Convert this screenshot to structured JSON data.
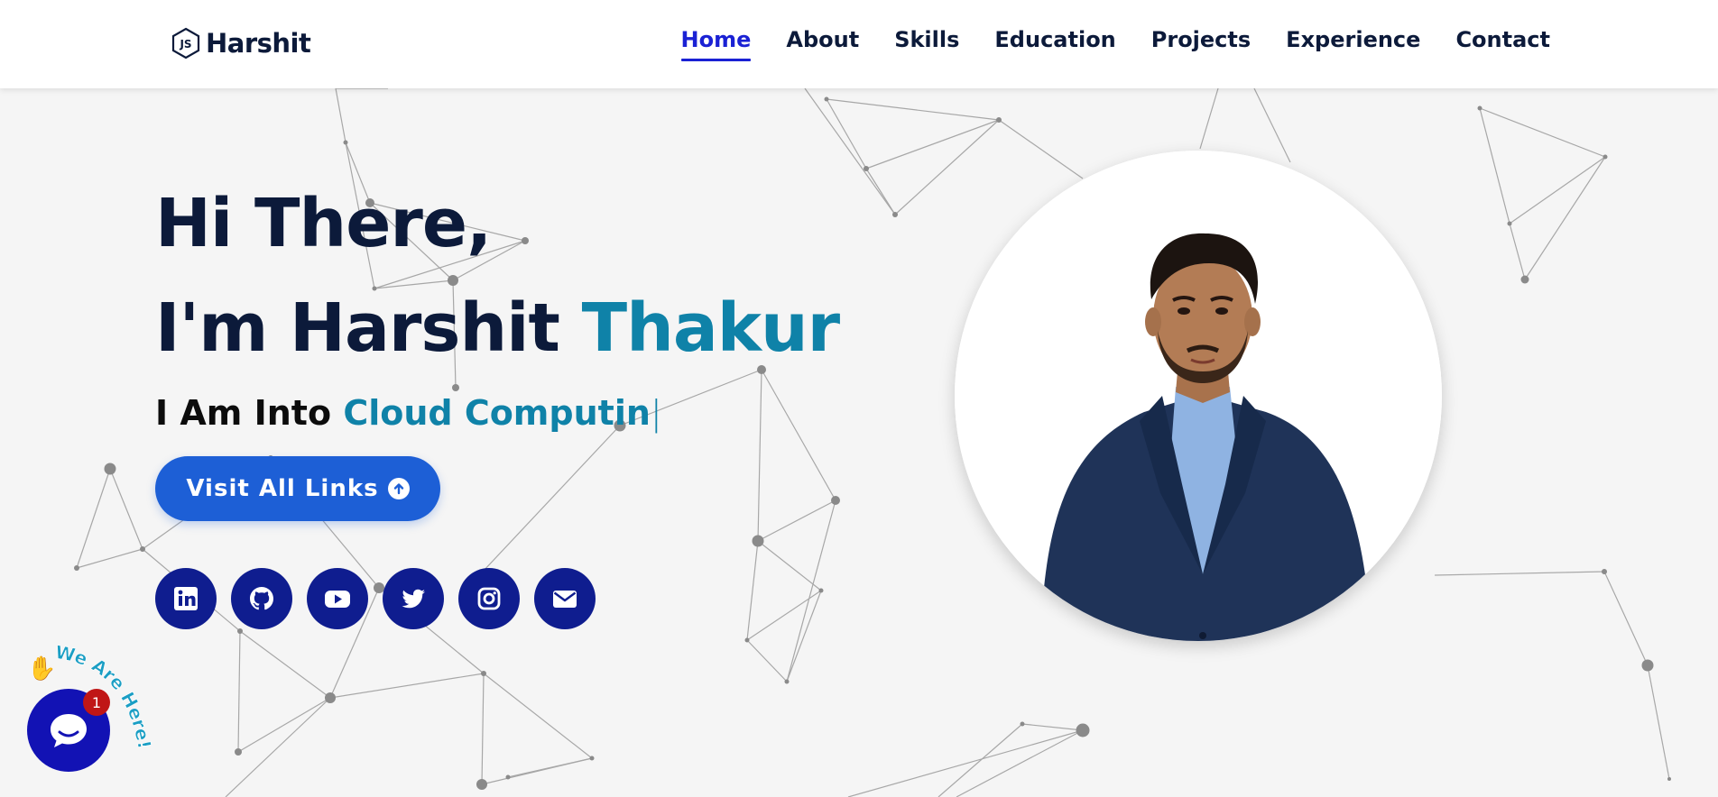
{
  "brand": {
    "name": "Harshit",
    "icon": "nodejs-icon"
  },
  "nav": {
    "items": [
      {
        "label": "Home",
        "active": true
      },
      {
        "label": "About",
        "active": false
      },
      {
        "label": "Skills",
        "active": false
      },
      {
        "label": "Education",
        "active": false
      },
      {
        "label": "Projects",
        "active": false
      },
      {
        "label": "Experience",
        "active": false
      },
      {
        "label": "Contact",
        "active": false
      }
    ]
  },
  "hero": {
    "greeting": "Hi There,",
    "intro_prefix": "I'm Harshit",
    "intro_accent": "Thakur",
    "typed_prefix": "I Am Into",
    "typed_text": "Cloud Computin",
    "caret": "|",
    "cta_label": "Visit All Links"
  },
  "socials": [
    {
      "icon": "linkedin-icon"
    },
    {
      "icon": "github-icon"
    },
    {
      "icon": "youtube-icon"
    },
    {
      "icon": "twitter-icon"
    },
    {
      "icon": "instagram-icon"
    },
    {
      "icon": "mail-icon"
    }
  ],
  "chat": {
    "label": "We Are Here!",
    "badge_count": "1",
    "wave_emoji": "✋"
  },
  "colors": {
    "primary": "#1a21d4",
    "accent": "#0f82a8",
    "dark": "#0c1a3a",
    "button": "#1d5fd6",
    "social_bg": "#0f1d8f",
    "chat_bg": "#1212b4",
    "badge": "#c01616"
  }
}
